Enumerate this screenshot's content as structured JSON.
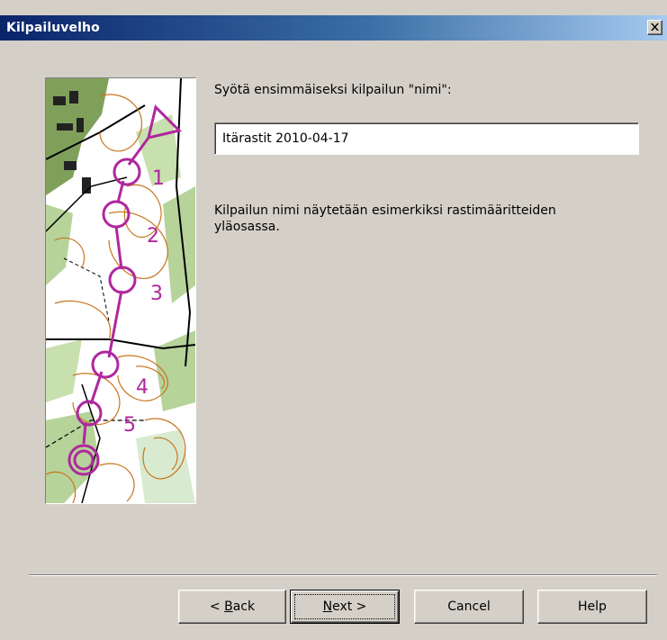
{
  "window": {
    "title": "Kilpailuvelho"
  },
  "content": {
    "prompt_label": "Syötä ensimmäiseksi kilpailun \"nimi\":",
    "name_value": "Itärastit 2010-04-17",
    "info_text": "Kilpailun nimi näytetään esimerkiksi rastimääritteiden yläosassa."
  },
  "image": {
    "control_numbers": [
      "1",
      "2",
      "3",
      "4",
      "5"
    ]
  },
  "buttons": {
    "back_prefix": "< ",
    "back_mnemonic": "B",
    "back_rest": "ack",
    "next_mnemonic": "N",
    "next_rest": "ext >",
    "cancel": "Cancel",
    "help": "Help"
  },
  "colors": {
    "title_gradient_start": "#0a246a",
    "title_gradient_end": "#a6caf0",
    "course_overprint": "#b0279e",
    "dialog_bg": "#d4d0c8"
  }
}
